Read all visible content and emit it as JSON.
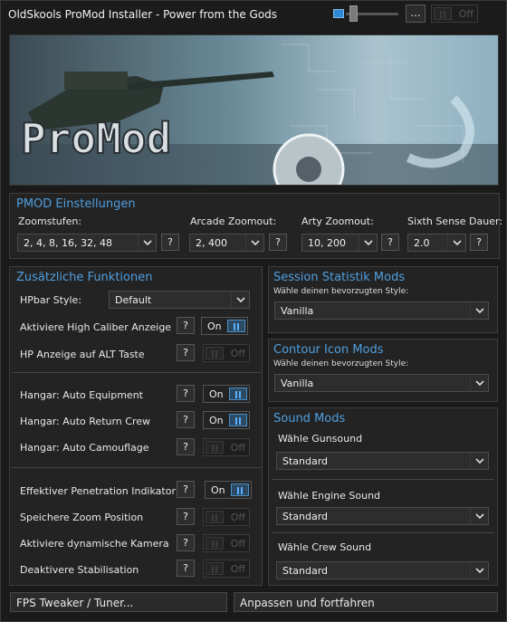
{
  "window": {
    "title": "OldSkools ProMod Installer - Power from the Gods",
    "menu_dots": "...",
    "top_toggle": "Off"
  },
  "banner": {
    "logo_text": "ProMod"
  },
  "pmod": {
    "title": "PMOD Einstellungen",
    "zoom_label": "Zoomstufen:",
    "zoom_value": "2, 4, 8, 16, 32, 48",
    "arcade_label": "Arcade Zoomout:",
    "arcade_value": "2, 400",
    "arty_label": "Arty Zoomout:",
    "arty_value": "10, 200",
    "sixth_label": "Sixth Sense Dauer:",
    "sixth_value": "2.0",
    "help": "?"
  },
  "extra": {
    "title": "Zusätzliche Funktionen",
    "hpbar_label": "HPbar Style:",
    "hpbar_value": "Default",
    "rows": [
      {
        "label": "Aktiviere High Caliber Anzeige",
        "state": "On"
      },
      {
        "label": "HP Anzeige auf ALT Taste",
        "state": "Off"
      },
      {
        "label": "Hangar: Auto Equipment",
        "state": "On"
      },
      {
        "label": "Hangar: Auto Return Crew",
        "state": "On"
      },
      {
        "label": "Hangar: Auto Camouflage",
        "state": "Off"
      },
      {
        "label": "Effektiver Penetration Indikator",
        "state": "On"
      },
      {
        "label": "Speichere Zoom Position",
        "state": "Off"
      },
      {
        "label": "Aktiviere dynamische Kamera",
        "state": "Off"
      },
      {
        "label": "Deaktivere Stabilisation",
        "state": "Off"
      }
    ]
  },
  "session": {
    "title": "Session Statistik Mods",
    "subtitle": "Wähle deinen bevorzugten Style:",
    "value": "Vanilla"
  },
  "contour": {
    "title": "Contour Icon Mods",
    "subtitle": "Wähle deinen bevorzugten Style:",
    "value": "Vanilla"
  },
  "sound": {
    "title": "Sound Mods",
    "gun_label": "Wähle Gunsound",
    "gun_value": "Standard",
    "engine_label": "Wähle Engine Sound",
    "engine_value": "Standard",
    "crew_label": "Wähle Crew Sound",
    "crew_value": "Standard"
  },
  "footer": {
    "fps_button": "FPS Tweaker / Tuner...",
    "continue_button": "Anpassen und fortfahren"
  },
  "colors": {
    "accent": "#4f9fe0",
    "background": "#1a1a1a",
    "panel": "#232323"
  }
}
